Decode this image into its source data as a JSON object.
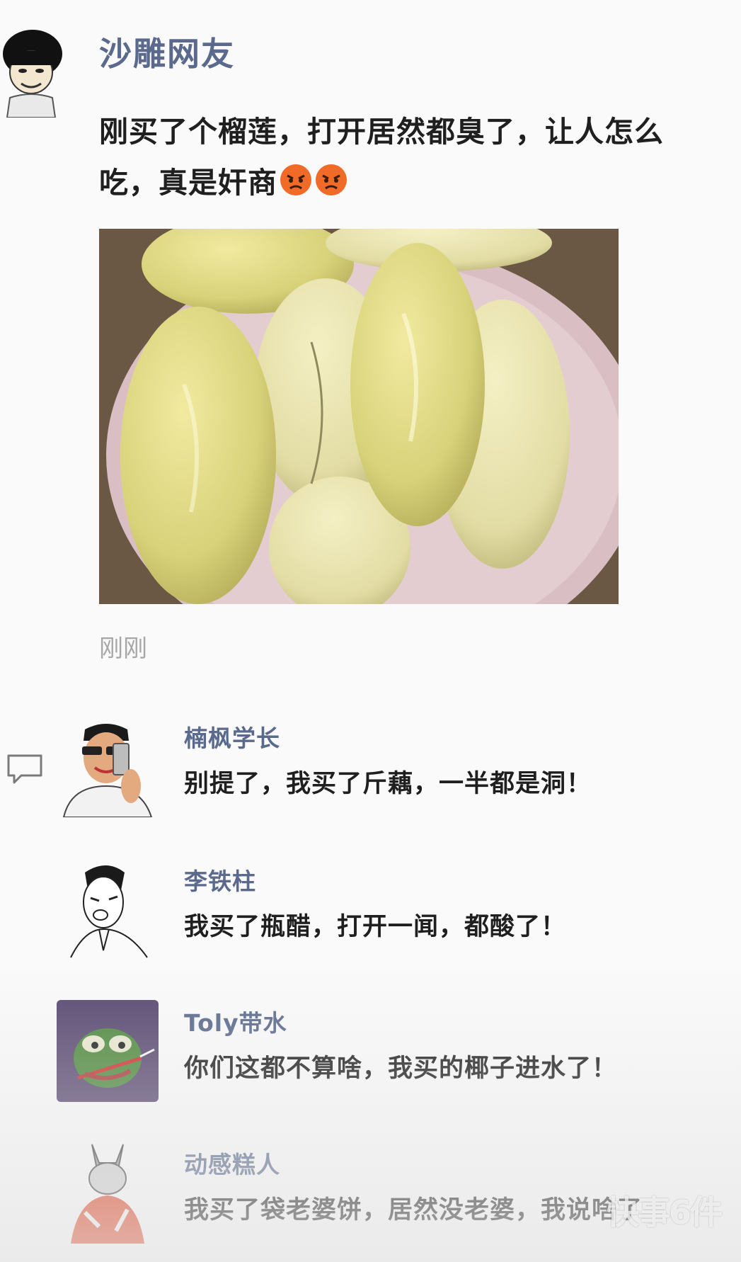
{
  "post": {
    "author": "沙雕网友",
    "text_line1": "刚买了个榴莲，打开居然都臭了，让人怎么",
    "text_line2": "吃，真是奸商",
    "emojis": [
      "angry-face-icon",
      "angry-face-icon"
    ],
    "timestamp": "刚刚"
  },
  "comments": [
    {
      "name": "楠枫学长",
      "text": "别提了，我买了斤藕，一半都是洞！",
      "avatar": "selfie-guy-avatar"
    },
    {
      "name": "李铁柱",
      "text": "我买了瓶醋，打开一闻，都酸了！",
      "avatar": "sketch-guy-avatar"
    },
    {
      "name": "Toly带水",
      "text": "你们这都不算啥，我买的椰子进水了！",
      "avatar": "pepe-frog-avatar"
    },
    {
      "name": "动感糕人",
      "text": "我买了袋老婆饼，居然没老婆，我说啥了",
      "avatar": "cartoon-character-avatar"
    }
  ],
  "watermark": "快事6件",
  "colors": {
    "name": "#5b6a8c",
    "timestamp": "#a7a7a7",
    "background": "#fafafa"
  }
}
